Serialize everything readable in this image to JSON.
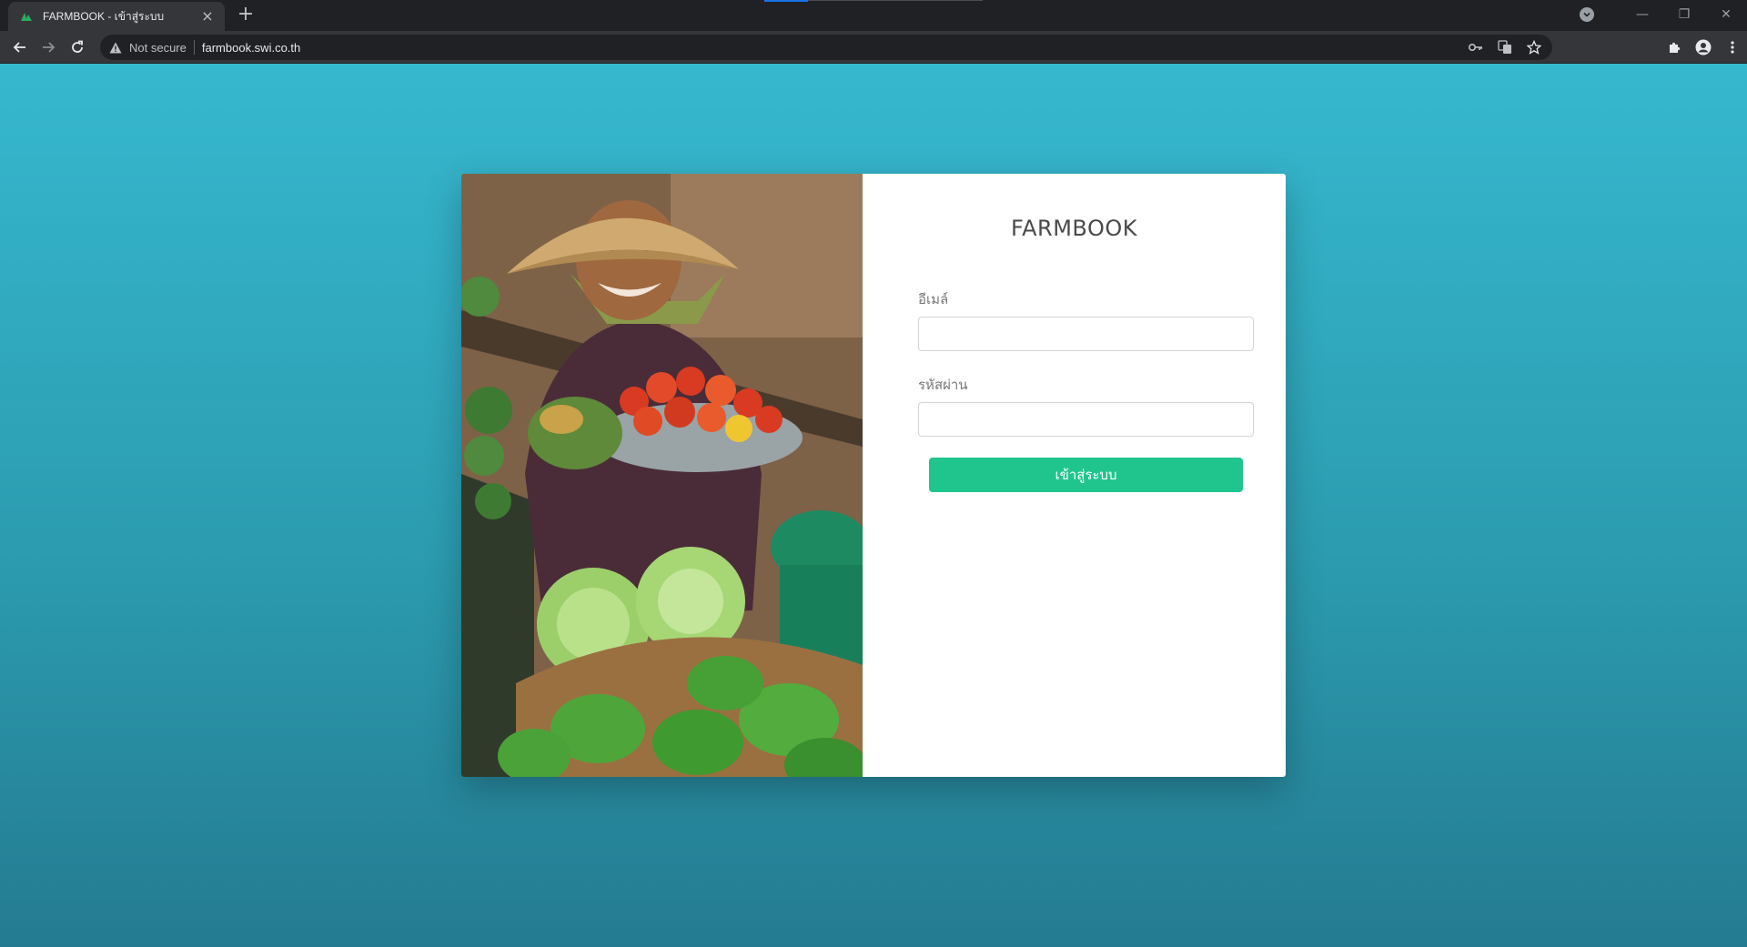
{
  "browser": {
    "tab": {
      "title": "FARMBOOK - เข้าสู่ระบบ",
      "close": "×"
    },
    "new_tab": "+",
    "omnibox": {
      "security_label": "Not secure",
      "url": "farmbook.swi.co.th"
    },
    "window_controls": {
      "minimize": "—",
      "maximize": "❐",
      "close": "✕"
    }
  },
  "login": {
    "brand": "FARMBOOK",
    "email_label": "อีเมล์",
    "email_value": "",
    "password_label": "รหัสผ่าน",
    "password_value": "",
    "submit_label": "เข้าสู่ระบบ"
  },
  "colors": {
    "accent": "#1fc58d",
    "background_top": "#36b8cf",
    "background_bottom": "#247b91"
  }
}
